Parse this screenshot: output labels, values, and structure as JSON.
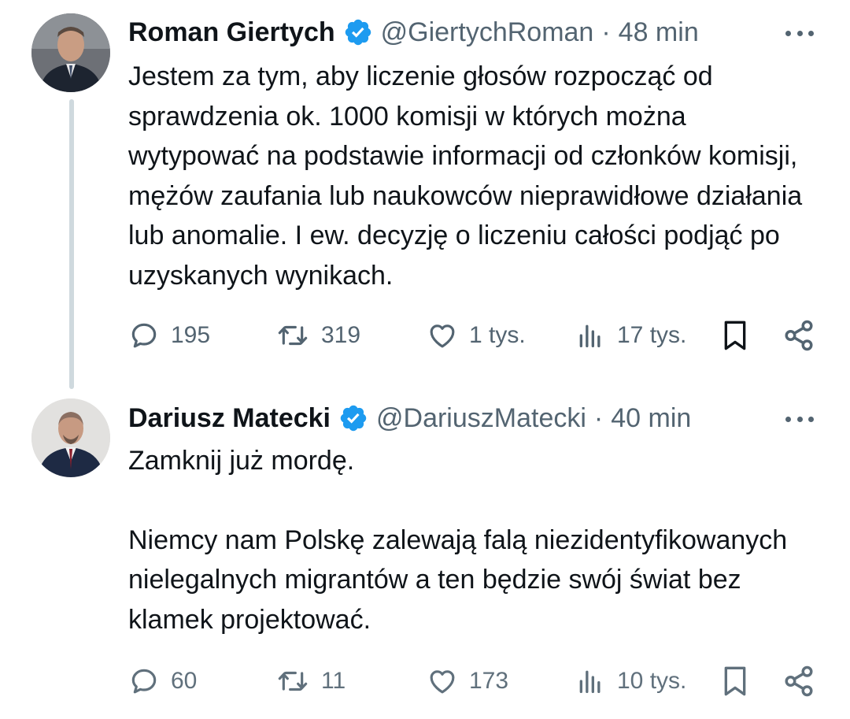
{
  "tweets": [
    {
      "author": "Roman Giertych",
      "handle": "@GiertychRoman",
      "separator": "·",
      "time": "48 min",
      "paragraphs": [
        "Jestem za tym, aby liczenie głosów rozpocząć od sprawdzenia ok. 1000 komisji w których można wytypować na podstawie informacji od członków komisji, mężów zaufania lub naukowców nieprawidłowe działania lub anomalie. I ew. decyzję o liczeniu całości podjąć po uzyskanych wynikach."
      ],
      "replies": "195",
      "reposts": "319",
      "likes": "1 tys.",
      "views": "17 tys."
    },
    {
      "author": "Dariusz Matecki",
      "handle": "@DariuszMatecki",
      "separator": "·",
      "time": "40 min",
      "paragraphs": [
        "Zamknij już mordę.",
        "Niemcy nam Polskę zalewają falą niezidentyfikowanych nielegalnych migrantów a ten będzie swój świat bez klamek projektować."
      ],
      "replies": "60",
      "reposts": "11",
      "likes": "173",
      "views": "10 tys."
    }
  ],
  "icons": {
    "verified": "verified-badge-icon",
    "more": "more-icon",
    "reply": "reply-icon",
    "repost": "repost-icon",
    "like": "like-icon",
    "views": "views-icon",
    "bookmark": "bookmark-icon",
    "share": "share-icon"
  },
  "colors": {
    "verified": "#1d9bf0",
    "text": "#0f1419",
    "secondary": "#536471",
    "thread_line": "#cfd9de"
  }
}
